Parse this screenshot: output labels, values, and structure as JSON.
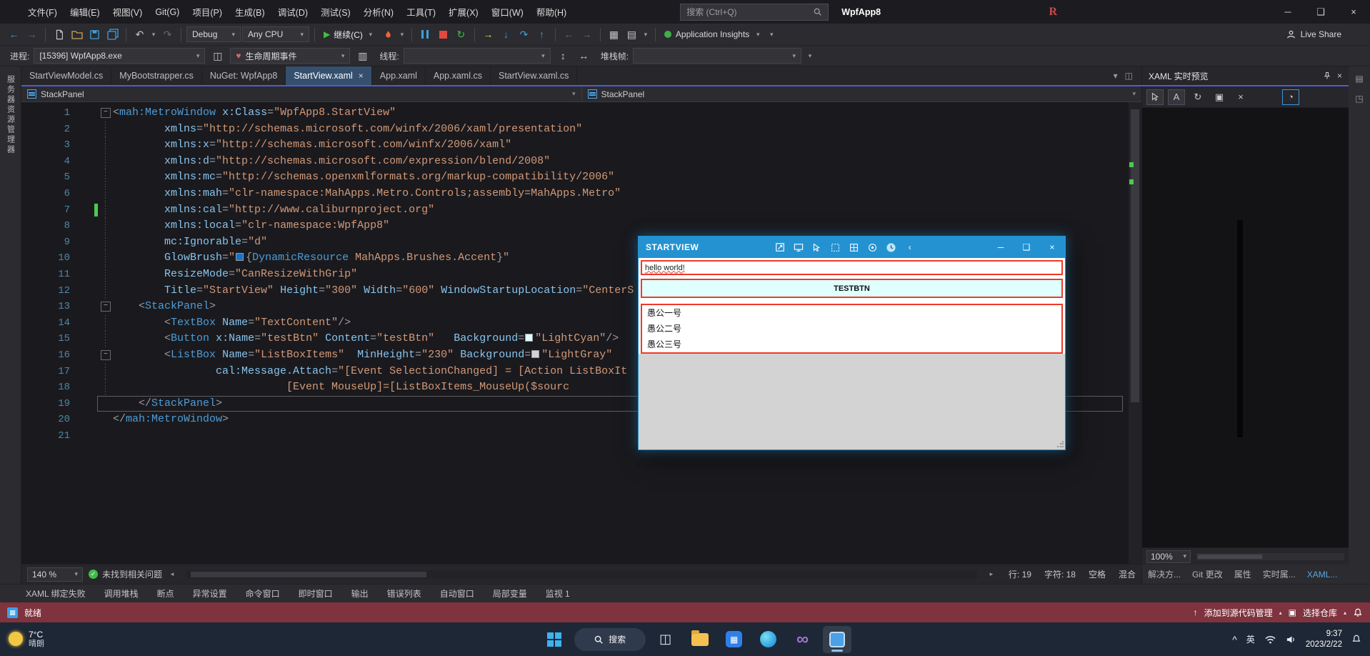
{
  "titlebar": {
    "menu_items": [
      "文件(F)",
      "编辑(E)",
      "视图(V)",
      "Git(G)",
      "项目(P)",
      "生成(B)",
      "调试(D)",
      "测试(S)",
      "分析(N)",
      "工具(T)",
      "扩展(X)",
      "窗口(W)",
      "帮助(H)"
    ],
    "search_placeholder": "搜索 (Ctrl+Q)",
    "app_title": "WpfApp8",
    "r_badge": "R"
  },
  "toolbar": {
    "debug_target": "Debug",
    "platform": "Any CPU",
    "continue_label": "继续(C)",
    "app_insights_label": "Application Insights",
    "live_share_label": "Live Share"
  },
  "debugbar": {
    "process_label": "进程:",
    "process_value": "[15396] WpfApp8.exe",
    "lifecycle_label": "生命周期事件",
    "thread_label": "线程:",
    "stackframe_label": "堆栈帧:"
  },
  "left_strip_label": "服务器资源管理器",
  "doc_tabs": [
    {
      "label": "StartViewModel.cs",
      "active": false
    },
    {
      "label": "MyBootstrapper.cs",
      "active": false
    },
    {
      "label": "NuGet: WpfApp8",
      "active": false
    },
    {
      "label": "StartView.xaml",
      "active": true
    },
    {
      "label": "App.xaml",
      "active": false
    },
    {
      "label": "App.xaml.cs",
      "active": false
    },
    {
      "label": "StartView.xaml.cs",
      "active": false
    }
  ],
  "breadcrumb": {
    "left": "StackPanel",
    "right": "StackPanel"
  },
  "editor": {
    "zoom": "140 %",
    "health": "未找到相关问题",
    "line_status": "行: 19",
    "char_status": "字符: 18",
    "space_status": "空格",
    "mix_status": "混合",
    "lines": [
      {
        "num": 1,
        "fold": true,
        "tokens": [
          [
            "p",
            "<"
          ],
          [
            "t",
            "mah:MetroWindow"
          ],
          [
            "n",
            " "
          ],
          [
            "a",
            "x:Class"
          ],
          [
            "p",
            "="
          ],
          [
            "v",
            "\"WpfApp8.StartView\""
          ]
        ]
      },
      {
        "num": 2,
        "guide": true,
        "tokens": [
          [
            "n",
            "        "
          ],
          [
            "a",
            "xmlns"
          ],
          [
            "p",
            "="
          ],
          [
            "v",
            "\"http://schemas.microsoft.com/winfx/2006/xaml/presentation\""
          ]
        ]
      },
      {
        "num": 3,
        "guide": true,
        "tokens": [
          [
            "n",
            "        "
          ],
          [
            "a",
            "xmlns:x"
          ],
          [
            "p",
            "="
          ],
          [
            "v",
            "\"http://schemas.microsoft.com/winfx/2006/xaml\""
          ]
        ]
      },
      {
        "num": 4,
        "guide": true,
        "tokens": [
          [
            "n",
            "        "
          ],
          [
            "a",
            "xmlns:d"
          ],
          [
            "p",
            "="
          ],
          [
            "v",
            "\"http://schemas.microsoft.com/expression/blend/2008\""
          ]
        ]
      },
      {
        "num": 5,
        "guide": true,
        "tokens": [
          [
            "n",
            "        "
          ],
          [
            "a",
            "xmlns:mc"
          ],
          [
            "p",
            "="
          ],
          [
            "v",
            "\"http://schemas.openxmlformats.org/markup-compatibility/2006\""
          ]
        ]
      },
      {
        "num": 6,
        "guide": true,
        "tokens": [
          [
            "n",
            "        "
          ],
          [
            "a",
            "xmlns:mah"
          ],
          [
            "p",
            "="
          ],
          [
            "v",
            "\"clr-namespace:MahApps.Metro.Controls;assembly=MahApps.Metro\""
          ]
        ]
      },
      {
        "num": 7,
        "guide": true,
        "change": true,
        "tokens": [
          [
            "n",
            "        "
          ],
          [
            "a",
            "xmlns:cal"
          ],
          [
            "p",
            "="
          ],
          [
            "v",
            "\"http://www.caliburnproject.org\""
          ]
        ]
      },
      {
        "num": 8,
        "guide": true,
        "tokens": [
          [
            "n",
            "        "
          ],
          [
            "a",
            "xmlns:local"
          ],
          [
            "p",
            "="
          ],
          [
            "v",
            "\"clr-namespace:WpfApp8\""
          ]
        ]
      },
      {
        "num": 9,
        "guide": true,
        "tokens": [
          [
            "n",
            "        "
          ],
          [
            "a",
            "mc:Ignorable"
          ],
          [
            "p",
            "="
          ],
          [
            "v",
            "\"d\""
          ]
        ]
      },
      {
        "num": 10,
        "guide": true,
        "tokens": [
          [
            "n",
            "        "
          ],
          [
            "a",
            "GlowBrush"
          ],
          [
            "p",
            "="
          ],
          [
            "v",
            "\""
          ],
          [
            "sw",
            "#1673cc"
          ],
          [
            "p",
            "{"
          ],
          [
            "k",
            "DynamicResource"
          ],
          [
            "v",
            " MahApps.Brushes.Accent"
          ],
          [
            "p",
            "}"
          ],
          [
            "v",
            "\""
          ]
        ]
      },
      {
        "num": 11,
        "guide": true,
        "tokens": [
          [
            "n",
            "        "
          ],
          [
            "a",
            "ResizeMode"
          ],
          [
            "p",
            "="
          ],
          [
            "v",
            "\"CanResizeWithGrip\""
          ]
        ]
      },
      {
        "num": 12,
        "guide": true,
        "tokens": [
          [
            "n",
            "        "
          ],
          [
            "a",
            "Title"
          ],
          [
            "p",
            "="
          ],
          [
            "v",
            "\"StartView\""
          ],
          [
            "n",
            " "
          ],
          [
            "a",
            "Height"
          ],
          [
            "p",
            "="
          ],
          [
            "v",
            "\"300\""
          ],
          [
            "n",
            " "
          ],
          [
            "a",
            "Width"
          ],
          [
            "p",
            "="
          ],
          [
            "v",
            "\"600\""
          ],
          [
            "n",
            " "
          ],
          [
            "a",
            "WindowStartupLocation"
          ],
          [
            "p",
            "="
          ],
          [
            "v",
            "\"CenterS"
          ]
        ]
      },
      {
        "num": 13,
        "fold": true,
        "tokens": [
          [
            "n",
            "    "
          ],
          [
            "p",
            "<"
          ],
          [
            "t",
            "StackPanel"
          ],
          [
            "p",
            ">"
          ]
        ]
      },
      {
        "num": 14,
        "guide": true,
        "tokens": [
          [
            "n",
            "        "
          ],
          [
            "p",
            "<"
          ],
          [
            "t",
            "TextBox"
          ],
          [
            "n",
            " "
          ],
          [
            "a",
            "Name"
          ],
          [
            "p",
            "="
          ],
          [
            "v",
            "\"TextContent\""
          ],
          [
            "p",
            "/>"
          ]
        ]
      },
      {
        "num": 15,
        "guide": true,
        "tokens": [
          [
            "n",
            "        "
          ],
          [
            "p",
            "<"
          ],
          [
            "t",
            "Button"
          ],
          [
            "n",
            " "
          ],
          [
            "a",
            "x:Name"
          ],
          [
            "p",
            "="
          ],
          [
            "v",
            "\"testBtn\""
          ],
          [
            "n",
            " "
          ],
          [
            "a",
            "Content"
          ],
          [
            "p",
            "="
          ],
          [
            "v",
            "\"testBtn\""
          ],
          [
            "n",
            "   "
          ],
          [
            "a",
            "Background"
          ],
          [
            "p",
            "="
          ],
          [
            "sw",
            "#e0ffff"
          ],
          [
            "v",
            "\"LightCyan\""
          ],
          [
            "p",
            "/>"
          ]
        ]
      },
      {
        "num": 16,
        "fold": true,
        "tokens": [
          [
            "n",
            "        "
          ],
          [
            "p",
            "<"
          ],
          [
            "t",
            "ListBox"
          ],
          [
            "n",
            " "
          ],
          [
            "a",
            "Name"
          ],
          [
            "p",
            "="
          ],
          [
            "v",
            "\"ListBoxItems\""
          ],
          [
            "n",
            "  "
          ],
          [
            "a",
            "MinHeight"
          ],
          [
            "p",
            "="
          ],
          [
            "v",
            "\"230\""
          ],
          [
            "n",
            " "
          ],
          [
            "a",
            "Background"
          ],
          [
            "p",
            "="
          ],
          [
            "sw",
            "#d3d3d3"
          ],
          [
            "v",
            "\"LightGray\""
          ]
        ]
      },
      {
        "num": 17,
        "guide": true,
        "tokens": [
          [
            "n",
            "                "
          ],
          [
            "a",
            "cal:Message.Attach"
          ],
          [
            "p",
            "="
          ],
          [
            "v",
            "\"[Event SelectionChanged] = [Action ListBoxIt"
          ]
        ]
      },
      {
        "num": 18,
        "guide": true,
        "tokens": [
          [
            "n",
            "                           "
          ],
          [
            "v",
            "[Event MouseUp]=[ListBoxItems_MouseUp($sourc"
          ]
        ]
      },
      {
        "num": 19,
        "current": true,
        "tokens": [
          [
            "n",
            "    "
          ],
          [
            "p",
            "</"
          ],
          [
            "t",
            "StackPanel"
          ],
          [
            "p",
            ">"
          ]
        ]
      },
      {
        "num": 20,
        "tokens": [
          [
            "p",
            "</"
          ],
          [
            "t",
            "mah:MetroWindow"
          ],
          [
            "p",
            ">"
          ]
        ]
      },
      {
        "num": 21,
        "tokens": []
      }
    ]
  },
  "live_preview_panel": {
    "title": "XAML 实时预览",
    "zoom": "100%",
    "dock_tabs": [
      "解决方...",
      "Git 更改",
      "属性",
      "实时属...",
      "XAML..."
    ]
  },
  "bottom_dock_tabs": [
    "XAML 绑定失败",
    "调用堆栈",
    "断点",
    "异常设置",
    "命令窗口",
    "即时窗口",
    "输出",
    "错误列表",
    "自动窗口",
    "局部变量",
    "监视 1"
  ],
  "statusbar": {
    "ready": "就绪",
    "add_to_scm": "添加到源代码管理",
    "select_repo": "选择仓库"
  },
  "app_window": {
    "title": "STARTVIEW",
    "textbox_text": "hello world!",
    "button_label": "TESTBTN",
    "list_items": [
      "愚公一号",
      "愚公二号",
      "愚公三号"
    ],
    "accent": "#2492d1",
    "adorner_red": "#ee3a2a",
    "button_bg": "#e0ffff",
    "list_footer_bg": "#d3d3d3"
  },
  "taskbar": {
    "temperature": "7°C",
    "weather": "晴朗",
    "search_label": "搜索",
    "ime": "英",
    "time": "9:37",
    "date": "2023/2/22"
  }
}
